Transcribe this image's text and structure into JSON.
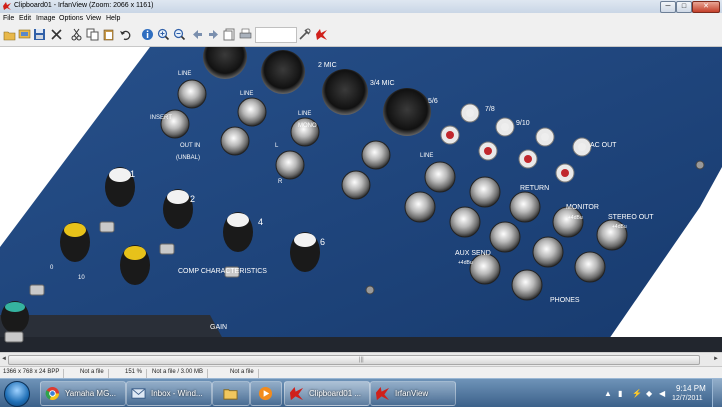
{
  "window": {
    "title": "Clipboard01 - IrfanView (Zoom: 2066 x 1161)",
    "controls": {
      "minimize": "─",
      "maximize": "□",
      "close": "✕"
    }
  },
  "menu": [
    "File",
    "Edit",
    "Image",
    "Options",
    "View",
    "Help"
  ],
  "toolbar": {
    "icons": [
      "open-folder-icon",
      "slideshow-icon",
      "save-icon",
      "delete-icon",
      "cut-icon",
      "copy-icon",
      "paste-icon",
      "undo-icon",
      "info-icon",
      "zoom-in-icon",
      "zoom-out-icon",
      "prev-icon",
      "next-icon",
      "page-icon",
      "print-icon",
      "settings-icon",
      "irfanview-logo-icon"
    ]
  },
  "image": {
    "labels": {
      "line_1": "LINE",
      "line_2": "LINE",
      "line_3": "LINE",
      "line_4": "LINE",
      "mic_2": "2 MIC",
      "mic_34": "3/4 MIC",
      "ch_56": "5/6",
      "ch_78": "7/8",
      "ch_910": "9/10",
      "insert": "INSERT",
      "out_in": "OUT  IN",
      "unbal": "(UNBAL)",
      "mono": "MONO",
      "l": "L",
      "r": "R",
      "ac_out": "AC OUT",
      "return": "RETURN",
      "monitor": "MONITOR",
      "monitor_level": "+4dBu",
      "stereo_out": "STEREO OUT",
      "stereo_level": "+4dBu",
      "aux_send": "AUX SEND",
      "aux_level": "+4dBu",
      "phones": "PHONES",
      "comp": "COMP  CHARACTERISTICS",
      "gain": "GAIN",
      "ch4": "4",
      "ch6": "6",
      "ch1": "1",
      "ch2": "2",
      "ten": "10",
      "zero": "0"
    }
  },
  "scrollbar": {
    "left_arrow": "◄",
    "right_arrow": "►",
    "grip": "|||"
  },
  "status": {
    "dimensions": "1366 x 768 x 24 BPP",
    "page": "Not a file",
    "zoom": "151 %",
    "size": "Not a file / 3.00 MB",
    "date": "Not a file"
  },
  "taskbar": {
    "tasks": [
      {
        "label": "Yamaha MG...",
        "icon": "chrome-icon"
      },
      {
        "label": "Inbox - Wind...",
        "icon": "mail-icon"
      },
      {
        "label": "",
        "icon": "folder-icon"
      },
      {
        "label": "",
        "icon": "media-player-icon"
      },
      {
        "label": "Clipboard01 ...",
        "icon": "irfanview-icon"
      },
      {
        "label": "IrfanView",
        "icon": "irfanview-icon"
      }
    ],
    "clock": {
      "time": "9:14 PM",
      "date": "12/7/2011"
    },
    "accent": "#3c618a"
  }
}
